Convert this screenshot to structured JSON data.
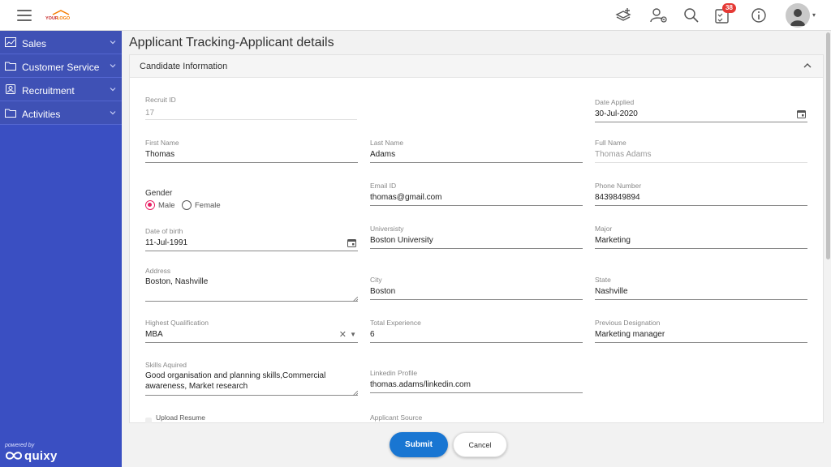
{
  "brand": {
    "logo_text": "YOUR LOGO",
    "powered_by": "powered by",
    "platform": "quixy"
  },
  "topbar": {
    "notification_count": "38"
  },
  "sidebar": {
    "items": [
      {
        "label": "Sales",
        "icon": "chart-icon"
      },
      {
        "label": "Customer Service",
        "icon": "folder-icon"
      },
      {
        "label": "Recruitment",
        "icon": "contact-icon"
      },
      {
        "label": "Activities",
        "icon": "folder-icon"
      }
    ]
  },
  "page": {
    "title": "Applicant Tracking-Applicant details"
  },
  "section": {
    "title": "Candidate Information"
  },
  "form": {
    "recruit_id": {
      "label": "Recruit ID",
      "value": "17"
    },
    "date_applied": {
      "label": "Date Applied",
      "value": "30-Jul-2020"
    },
    "first_name": {
      "label": "First Name",
      "value": "Thomas"
    },
    "last_name": {
      "label": "Last Name",
      "value": "Adams"
    },
    "full_name": {
      "label": "Full Name",
      "value": "Thomas Adams"
    },
    "gender": {
      "label": "Gender",
      "options": [
        "Male",
        "Female"
      ],
      "selected": "Male"
    },
    "email": {
      "label": "Email ID",
      "value": "thomas@gmail.com"
    },
    "phone": {
      "label": "Phone Number",
      "value": "8439849894"
    },
    "dob": {
      "label": "Date of birth",
      "value": "11-Jul-1991"
    },
    "university": {
      "label": "Universisty",
      "value": "Boston University"
    },
    "major": {
      "label": "Major",
      "value": "Marketing"
    },
    "address": {
      "label": "Address",
      "value": "Boston, Nashville"
    },
    "city": {
      "label": "City",
      "value": "Boston"
    },
    "state": {
      "label": "State",
      "value": "Nashville"
    },
    "qualification": {
      "label": "Highest Qualification",
      "value": "MBA"
    },
    "experience": {
      "label": "Total Experience",
      "value": "6"
    },
    "prev_designation": {
      "label": "Previous Designation",
      "value": "Marketing manager"
    },
    "skills": {
      "label": "Skills Aquired",
      "value": "Good organisation and planning skills,Commercial awareness, Market research"
    },
    "linkedin": {
      "label": "Linkedin Profile",
      "value": "thomas.adams/linkedin.com"
    },
    "upload_resume": {
      "label": "Upload Resume"
    },
    "applicant_source": {
      "label": "Applicant Source"
    }
  },
  "actions": {
    "submit": "Submit",
    "cancel": "Cancel"
  },
  "colors": {
    "sidebar": "#3a4fc2",
    "primary_button": "#1976d2",
    "radio_selected": "#e91e63",
    "badge": "#e53935"
  }
}
